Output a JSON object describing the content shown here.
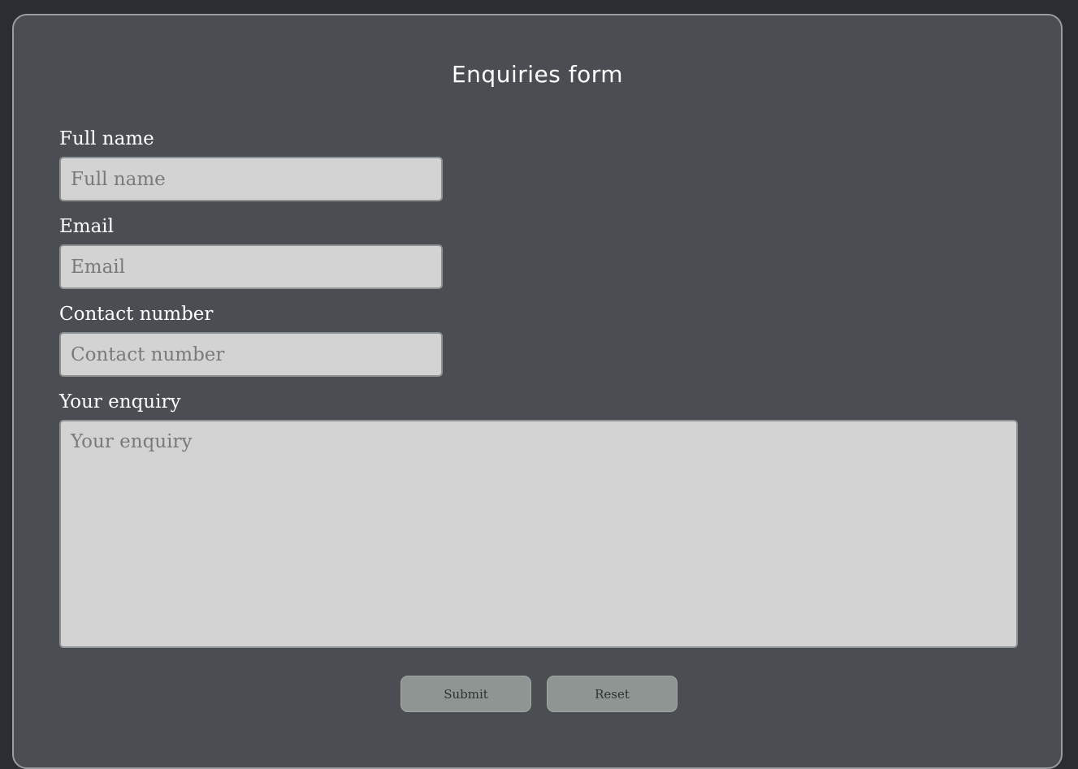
{
  "form": {
    "title": "Enquiries form",
    "fields": [
      {
        "label": "Full name",
        "placeholder": "Full name",
        "value": ""
      },
      {
        "label": "Email",
        "placeholder": "Email",
        "value": ""
      },
      {
        "label": "Contact number",
        "placeholder": "Contact number",
        "value": ""
      }
    ],
    "enquiry": {
      "label": "Your enquiry",
      "placeholder": "Your enquiry",
      "value": ""
    },
    "buttons": {
      "submit_label": "Submit",
      "reset_label": "Reset"
    }
  },
  "colors": {
    "page_background": "#2b2d32",
    "card_background": "#4a4d52",
    "input_background": "#d3d3d3",
    "button_background": "#8e9592",
    "text_light": "#ffffff"
  }
}
